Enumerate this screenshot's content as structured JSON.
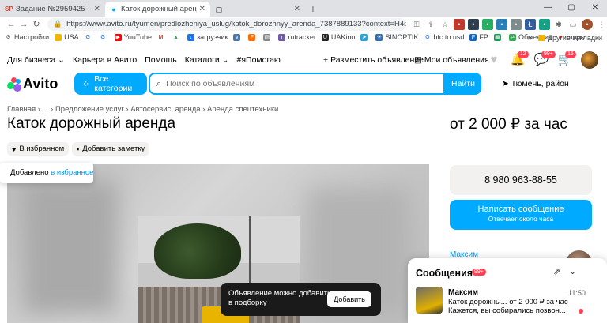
{
  "browser": {
    "tabs": [
      {
        "icon": "sp-icon",
        "title": "Задание №2959425 - просмотр ...",
        "active": false
      },
      {
        "icon": "avito-icon",
        "title": "Каток дорожный аренда (73878...",
        "active": true
      },
      {
        "icon": "blank-page-icon",
        "title": "",
        "active": false
      }
    ],
    "url": "https://www.avito.ru/tyumen/predlozheniya_uslug/katok_dorozhnyy_arenda_7387889133?context=H4sIAAAAAAAA_wE_AMD_...",
    "bookmarks": [
      {
        "label": "Настройки",
        "icon": "gear-icon",
        "color": "#5f6368"
      },
      {
        "label": "USA",
        "icon": "folder-icon",
        "color": "#f2b600"
      },
      {
        "label": "",
        "icon": "google-icon",
        "color": "#4285f4"
      },
      {
        "label": "",
        "icon": "google-icon",
        "color": "#4285f4"
      },
      {
        "label": "YouTube",
        "icon": "youtube-icon",
        "color": "#ff0000"
      },
      {
        "label": "",
        "icon": "gmail-icon",
        "color": "#ea4335"
      },
      {
        "label": "",
        "icon": "drive-icon",
        "color": "#34a853"
      },
      {
        "label": "загрузчик",
        "icon": "download-icon",
        "color": "#1a73e8"
      },
      {
        "label": "",
        "icon": "vk-icon",
        "color": "#4a76a8"
      },
      {
        "label": "",
        "icon": "f-icon",
        "color": "#ff6d00"
      },
      {
        "label": "",
        "icon": "doc-icon",
        "color": "#888888"
      },
      {
        "label": "rutracker",
        "icon": "rutracker-icon",
        "color": "#6e5aa5"
      },
      {
        "label": "UAKino",
        "icon": "uakino-icon",
        "color": "#222222"
      },
      {
        "label": "",
        "icon": "telegram-icon",
        "color": "#2aa3dd"
      },
      {
        "label": "SINOPTIK",
        "icon": "sinoptik-icon",
        "color": "#2c6fb7"
      },
      {
        "label": "btc to usd",
        "icon": "google-icon",
        "color": "#4285f4"
      },
      {
        "label": "FP",
        "icon": "fp-icon",
        "color": "#1565c0"
      },
      {
        "label": "",
        "icon": "sheet-icon",
        "color": "#0f9d58"
      },
      {
        "label": "Обменник",
        "icon": "exchange-icon",
        "color": "#34a853"
      },
      {
        "label": "maps",
        "icon": "maps-icon",
        "color": "#ea4335"
      }
    ],
    "bookmarks_right": "Другие закладки"
  },
  "header": {
    "links": [
      "Для бизнеса ⌄",
      "Карьера в Авито",
      "Помощь",
      "Каталоги ⌄",
      "#яПомогаю"
    ],
    "post_ad": "Разместить объявление",
    "my_ads": "Мои объявления",
    "badges": {
      "notifications": "12",
      "messages": "99+",
      "cart": "16"
    }
  },
  "search": {
    "logo": "Avito",
    "categories_label": "Все категории",
    "placeholder": "Поиск по объявлениям",
    "find_label": "Найти",
    "location": "Тюмень, район"
  },
  "breadcrumb": "Главная  ›  ...  ›  Предложение услуг  ›  Автосервис, аренда  ›  Аренда спецтехники",
  "listing": {
    "title": "Каток дорожный аренда",
    "price": "от 2 000 ₽ за час",
    "favorite_label": "В избранном",
    "note_label": "Добавить заметку"
  },
  "toast": {
    "text": "Добавлено ",
    "link": "в избранное"
  },
  "tooltip": {
    "line1": "Объявление можно добавить",
    "line2": "в подборку",
    "button": "Добавить"
  },
  "contact": {
    "phone": "8 980 963-88-55",
    "write_label": "Написать сообщение",
    "reply_time": "Отвечает около часа",
    "seller_name": "Максим"
  },
  "chat": {
    "title": "Сообщения",
    "badge": "99+",
    "items": [
      {
        "name": "Максим",
        "time": "11:50",
        "line1": "Каток дорожны... от 2 000 ₽ за час",
        "line2": "Кажется, вы собирались позвон..."
      }
    ]
  },
  "colors": {
    "accent": "#00aaff",
    "badge": "#ff4053",
    "link": "#0099f7"
  }
}
